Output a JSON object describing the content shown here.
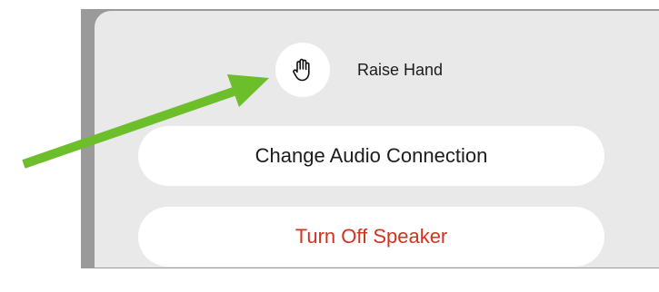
{
  "menu": {
    "raise_hand": {
      "label": "Raise Hand",
      "icon": "raised-hand-icon"
    },
    "change_audio": {
      "label": "Change Audio Connection"
    },
    "turn_off_speaker": {
      "label": "Turn Off Speaker"
    }
  },
  "annotation": {
    "arrow_color": "#6cbf2b",
    "points_to": "raised-hand-icon"
  },
  "colors": {
    "sheet_background": "#e9e9e9",
    "destructive_text": "#d2321f",
    "primary_text": "#1c1c1c"
  }
}
